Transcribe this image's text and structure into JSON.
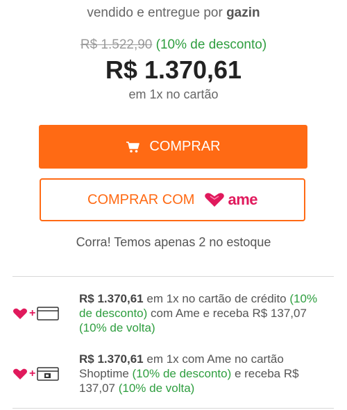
{
  "seller": {
    "prefix": "vendido e entregue por ",
    "name": "gazin"
  },
  "pricing": {
    "old_price": "R$ 1.522,90",
    "discount": "(10% de desconto)",
    "price": "R$ 1.370,61",
    "installments": "em 1x no cartão"
  },
  "buttons": {
    "buy_label": "COMPRAR",
    "ame_label": "COMPRAR COM",
    "ame_brand": "ame"
  },
  "stock": {
    "message": "Corra! Temos apenas 2 no estoque"
  },
  "offers": [
    {
      "price": "R$ 1.370,61",
      "part1": " em 1x no cartão de crédito ",
      "discount": "(10% de desconto)",
      "part2": " com Ame e receba R$ 137,07 ",
      "cashback": "(10% de volta)",
      "card_icon": "credit-card-icon"
    },
    {
      "price": "R$ 1.370,61",
      "part1": " em 1x com Ame no cartão Shoptime ",
      "discount": "(10% de desconto)",
      "part2": " e receba R$ 137,07 ",
      "cashback": "(10% de volta)",
      "card_icon": "shoptime-card-icon"
    }
  ],
  "colors": {
    "accent": "#ff6a14",
    "ame_pink": "#e0195c",
    "green": "#2e9e3f"
  },
  "icons": [
    "cart-icon",
    "ame-heart-icon",
    "credit-card-icon",
    "shoptime-card-icon"
  ]
}
